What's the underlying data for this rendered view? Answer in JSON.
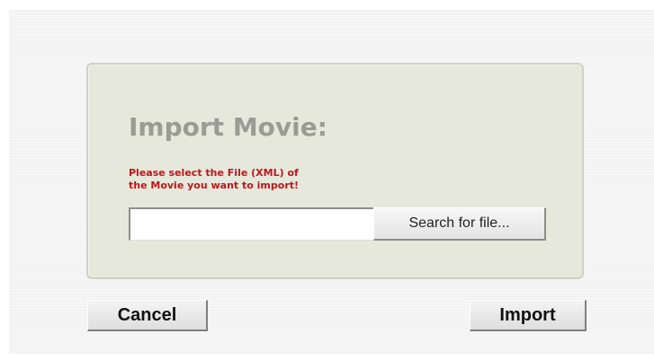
{
  "dialog": {
    "title": "Import Movie:",
    "instruction_lines": [
      "Please select the File (XML) of",
      "the Movie you want to import!"
    ],
    "file_input_value": "",
    "search_button_label": "Search for file...",
    "cancel_label": "Cancel",
    "import_label": "Import"
  },
  "colors": {
    "panel_background": "#e6e8dc",
    "title_text": "#9a9c94",
    "instruction_text": "#c0161a"
  }
}
